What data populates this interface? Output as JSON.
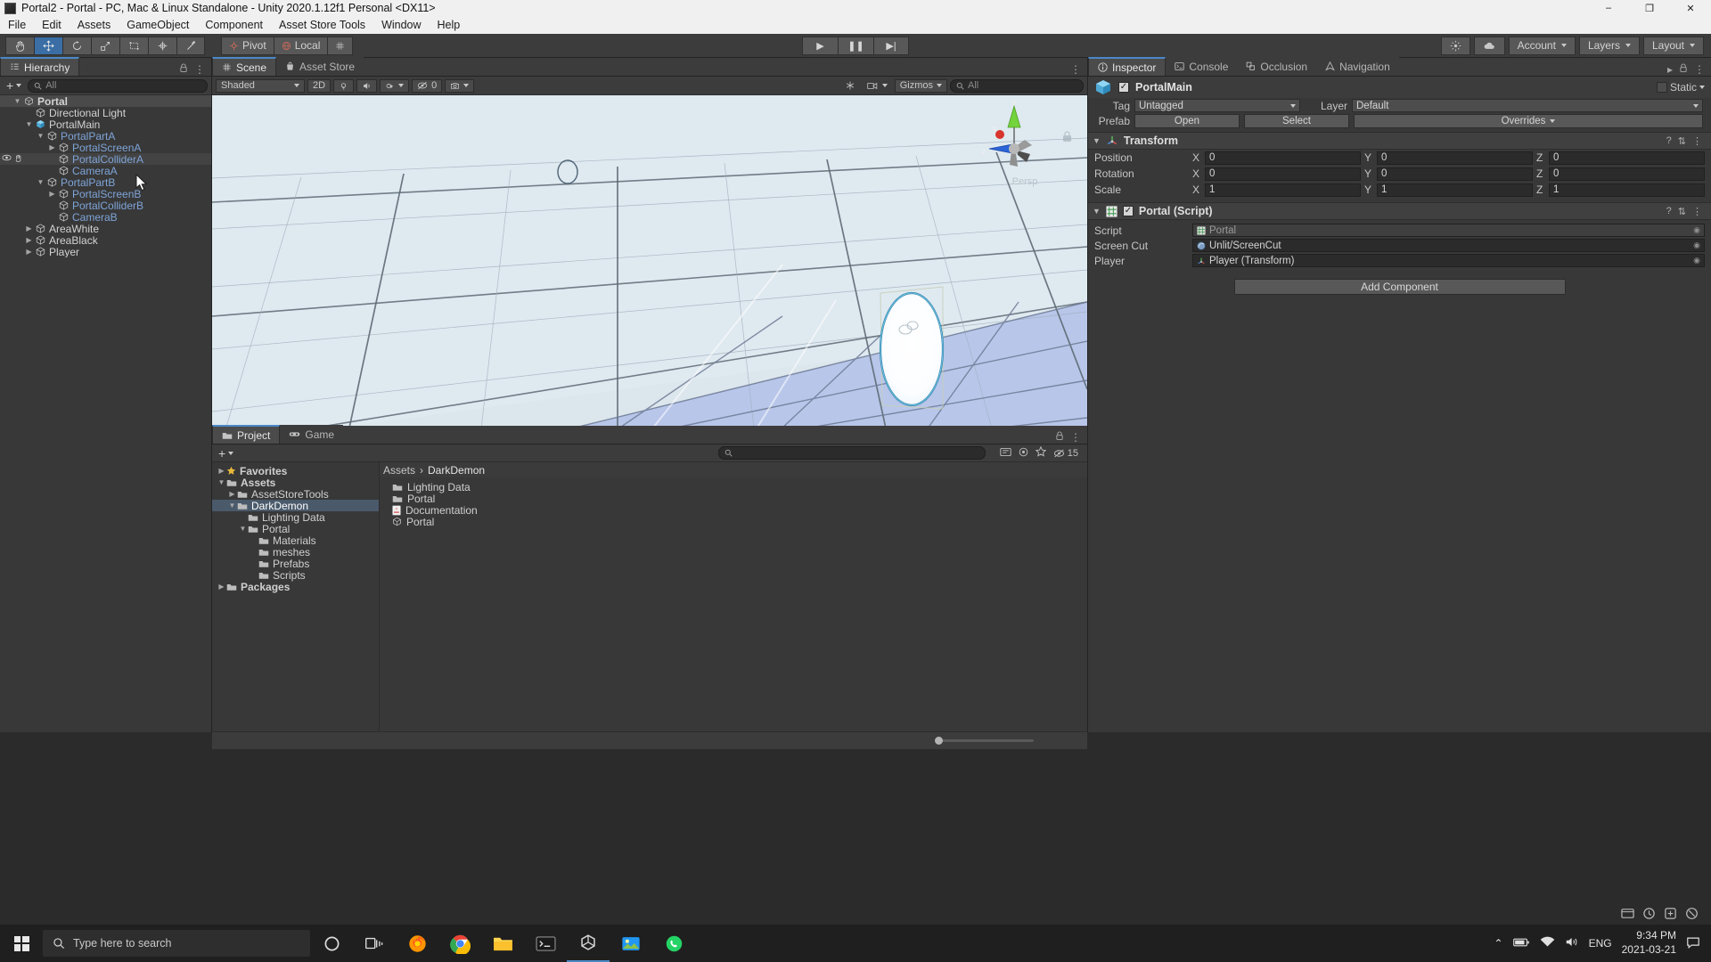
{
  "window": {
    "title": "Portal2 - Portal - PC, Mac & Linux Standalone - Unity 2020.1.12f1 Personal <DX11>",
    "minimize": "–",
    "maximize": "❐",
    "close": "✕"
  },
  "menubar": [
    "File",
    "Edit",
    "Assets",
    "GameObject",
    "Component",
    "Asset Store Tools",
    "Window",
    "Help"
  ],
  "toolbar": {
    "transform_tools": [
      "hand-tool",
      "move-tool",
      "rotate-tool",
      "scale-tool",
      "rect-tool",
      "transform-tool",
      "custom-tool"
    ],
    "pivot_label": "Pivot",
    "local_label": "Local",
    "grid_label": "grid-snap",
    "play": "▶",
    "pause": "❚❚",
    "step": "▶|",
    "collab_label": "collab-icon",
    "cloud_label": "cloud-icon",
    "account_label": "Account",
    "layers_label": "Layers",
    "layout_label": "Layout"
  },
  "hierarchy": {
    "tab": "Hierarchy",
    "search_placeholder": "All",
    "add_label": "+",
    "items": [
      {
        "label": "Portal",
        "depth": 0,
        "twisty": "down",
        "icon": "scene-icon",
        "style": "white bold",
        "selected": true,
        "hovered": false,
        "vis": false
      },
      {
        "label": "Directional Light",
        "depth": 1,
        "twisty": "none",
        "icon": "gameobject-icon",
        "style": "white",
        "selected": false,
        "hovered": false,
        "vis": false
      },
      {
        "label": "PortalMain",
        "depth": 1,
        "twisty": "down",
        "icon": "prefab-icon",
        "style": "white",
        "selected": false,
        "hovered": false,
        "vis": false
      },
      {
        "label": "PortalPartA",
        "depth": 2,
        "twisty": "down",
        "icon": "gameobject-icon",
        "style": "prefab",
        "selected": false,
        "hovered": false,
        "vis": false
      },
      {
        "label": "PortalScreenA",
        "depth": 3,
        "twisty": "right",
        "icon": "gameobject-icon",
        "style": "prefab",
        "selected": false,
        "hovered": false,
        "vis": false
      },
      {
        "label": "PortalColliderA",
        "depth": 3,
        "twisty": "none",
        "icon": "gameobject-icon",
        "style": "prefab",
        "selected": false,
        "hovered": true,
        "vis": true
      },
      {
        "label": "CameraA",
        "depth": 3,
        "twisty": "none",
        "icon": "gameobject-icon",
        "style": "prefab",
        "selected": false,
        "hovered": false,
        "vis": false
      },
      {
        "label": "PortalPartB",
        "depth": 2,
        "twisty": "down",
        "icon": "gameobject-icon",
        "style": "prefab",
        "selected": false,
        "hovered": false,
        "vis": false
      },
      {
        "label": "PortalScreenB",
        "depth": 3,
        "twisty": "right",
        "icon": "gameobject-icon",
        "style": "prefab",
        "selected": false,
        "hovered": false,
        "vis": false
      },
      {
        "label": "PortalColliderB",
        "depth": 3,
        "twisty": "none",
        "icon": "gameobject-icon",
        "style": "prefab",
        "selected": false,
        "hovered": false,
        "vis": false
      },
      {
        "label": "CameraB",
        "depth": 3,
        "twisty": "none",
        "icon": "gameobject-icon",
        "style": "prefab",
        "selected": false,
        "hovered": false,
        "vis": false
      },
      {
        "label": "AreaWhite",
        "depth": 1,
        "twisty": "right",
        "icon": "gameobject-icon",
        "style": "white",
        "selected": false,
        "hovered": false,
        "vis": false
      },
      {
        "label": "AreaBlack",
        "depth": 1,
        "twisty": "right",
        "icon": "gameobject-icon",
        "style": "white",
        "selected": false,
        "hovered": false,
        "vis": false
      },
      {
        "label": "Player",
        "depth": 1,
        "twisty": "right",
        "icon": "gameobject-icon",
        "style": "white",
        "selected": false,
        "hovered": false,
        "vis": false
      }
    ]
  },
  "scene": {
    "tabs": [
      {
        "label": "Scene",
        "icon": "scene-grid-icon",
        "active": true
      },
      {
        "label": "Asset Store",
        "icon": "store-bag-icon",
        "active": false
      }
    ],
    "shading_mode": "Shaded",
    "mode_2d": "2D",
    "lighting_icon": "lighting-icon",
    "audio_icon": "audio-icon",
    "fx_icon": "fx-icon",
    "hidden_count": "0",
    "scene_vis_icon": "scene-vis-icon",
    "gizmos_label": "Gizmos",
    "search_placeholder": "All",
    "gizmo_axes": [
      "x",
      "y",
      "z"
    ],
    "projection_label": "Persp"
  },
  "project": {
    "tabs": [
      {
        "label": "Project",
        "icon": "folder-icon",
        "active": true
      },
      {
        "label": "Game",
        "icon": "gamepad-icon",
        "active": false
      }
    ],
    "add_label": "+",
    "search_placeholder": "",
    "asset_count": "15",
    "breadcrumb": [
      "Assets",
      "DarkDemon"
    ],
    "tree": [
      {
        "label": "Favorites",
        "depth": 0,
        "twisty": "right",
        "icon": "star-icon",
        "selected": false
      },
      {
        "label": "Assets",
        "depth": 0,
        "twisty": "down",
        "icon": "folder-icon",
        "selected": false
      },
      {
        "label": "AssetStoreTools",
        "depth": 1,
        "twisty": "right",
        "icon": "folder-icon",
        "selected": false
      },
      {
        "label": "DarkDemon",
        "depth": 1,
        "twisty": "down",
        "icon": "folder-icon",
        "selected": true
      },
      {
        "label": "Lighting Data",
        "depth": 2,
        "twisty": "none",
        "icon": "folder-icon",
        "selected": false
      },
      {
        "label": "Portal",
        "depth": 2,
        "twisty": "down",
        "icon": "folder-icon",
        "selected": false
      },
      {
        "label": "Materials",
        "depth": 3,
        "twisty": "none",
        "icon": "folder-icon",
        "selected": false
      },
      {
        "label": "meshes",
        "depth": 3,
        "twisty": "none",
        "icon": "folder-icon",
        "selected": false
      },
      {
        "label": "Prefabs",
        "depth": 3,
        "twisty": "none",
        "icon": "folder-icon",
        "selected": false
      },
      {
        "label": "Scripts",
        "depth": 3,
        "twisty": "none",
        "icon": "folder-icon",
        "selected": false
      },
      {
        "label": "Packages",
        "depth": 0,
        "twisty": "right",
        "icon": "folder-icon",
        "selected": false
      }
    ],
    "assets": [
      {
        "label": "Lighting Data",
        "icon": "folder-icon"
      },
      {
        "label": "Portal",
        "icon": "folder-icon"
      },
      {
        "label": "Documentation",
        "icon": "pdf-icon"
      },
      {
        "label": "Portal",
        "icon": "scene-icon"
      }
    ]
  },
  "inspector": {
    "tabs": [
      {
        "label": "Inspector",
        "icon": "info-icon",
        "active": true
      },
      {
        "label": "Console",
        "icon": "console-icon",
        "active": false
      },
      {
        "label": "Occlusion",
        "icon": "occlusion-icon",
        "active": false
      },
      {
        "label": "Navigation",
        "icon": "navigation-icon",
        "active": false
      }
    ],
    "object_name": "PortalMain",
    "enabled": true,
    "static_label": "Static",
    "tag_label": "Tag",
    "tag_value": "Untagged",
    "layer_label": "Layer",
    "layer_value": "Default",
    "prefab_label": "Prefab",
    "prefab_open": "Open",
    "prefab_select": "Select",
    "prefab_overrides": "Overrides",
    "transform": {
      "title": "Transform",
      "rows": [
        {
          "label": "Position",
          "x": "0",
          "y": "0",
          "z": "0"
        },
        {
          "label": "Rotation",
          "x": "0",
          "y": "0",
          "z": "0"
        },
        {
          "label": "Scale",
          "x": "1",
          "y": "1",
          "z": "1"
        }
      ],
      "axes": [
        "X",
        "Y",
        "Z"
      ]
    },
    "script_component": {
      "title": "Portal (Script)",
      "enabled": true,
      "rows": [
        {
          "label": "Script",
          "value": "Portal",
          "icon": "script-icon",
          "disabled": true
        },
        {
          "label": "Screen Cut",
          "value": "Unlit/ScreenCut",
          "icon": "material-icon",
          "disabled": false
        },
        {
          "label": "Player",
          "value": "Player (Transform)",
          "icon": "transform-icon",
          "disabled": false
        }
      ]
    },
    "add_component": "Add Component"
  },
  "taskbar": {
    "search_placeholder": "Type here to search",
    "apps": [
      {
        "name": "cortana-icon"
      },
      {
        "name": "task-view-icon"
      },
      {
        "name": "firefox-icon"
      },
      {
        "name": "chrome-icon"
      },
      {
        "name": "file-explorer-icon"
      },
      {
        "name": "terminal-icon"
      },
      {
        "name": "unity-icon"
      },
      {
        "name": "photos-icon"
      },
      {
        "name": "whatsapp-icon"
      }
    ],
    "language": "ENG",
    "time": "9:34 PM",
    "date": "2021-03-21",
    "chevron": "⌃"
  },
  "colors": {
    "accent_blue": "#4a88c7",
    "prefab_blue": "#7ea4d8",
    "panel_bg": "#383838",
    "toolbar_bg": "#3c3c3c",
    "selection": "#4a5a6b"
  }
}
